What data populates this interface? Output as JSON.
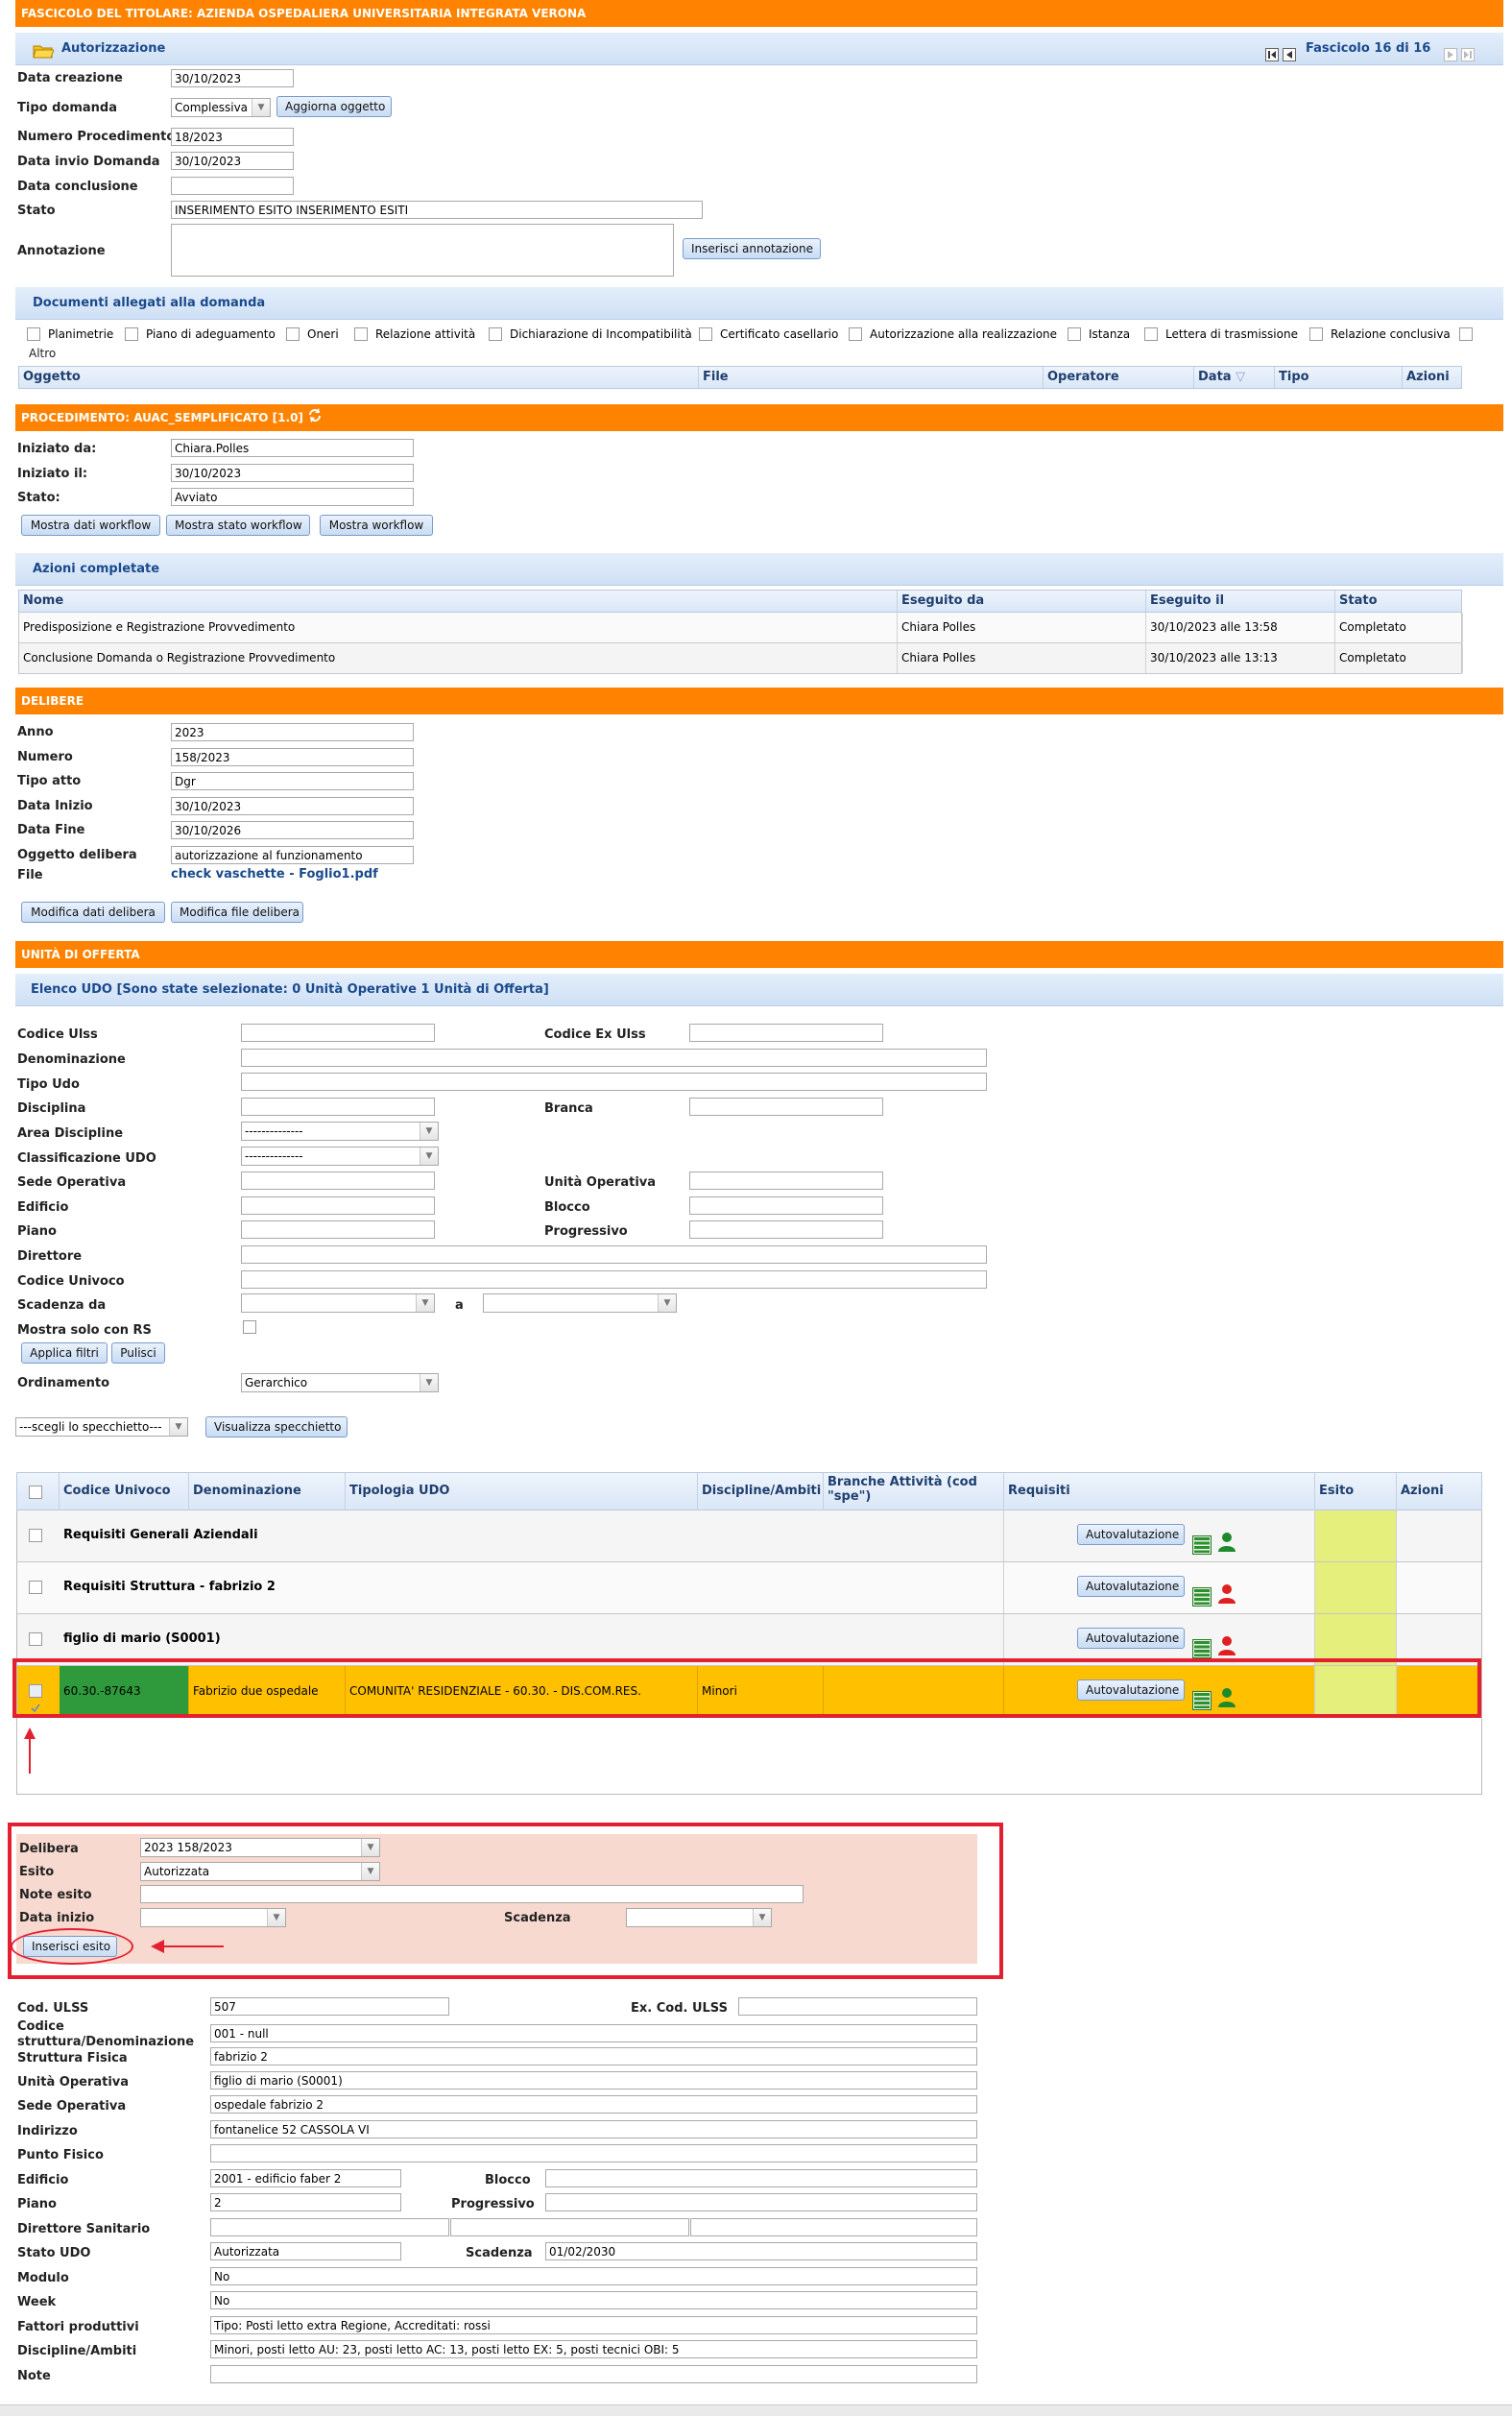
{
  "fascicolo": {
    "title": "FASCICOLO DEL TITOLARE: AZIENDA OSPEDALIERA UNIVERSITARIA INTEGRATA VERONA",
    "tab": "Autorizzazione",
    "pager": "Fascicolo 16 di 16"
  },
  "domanda": {
    "labels": {
      "data_creazione": "Data creazione",
      "tipo_domanda": "Tipo domanda",
      "numero_procedimento": "Numero Procedimento",
      "data_invio": "Data invio Domanda",
      "data_conclusione": "Data conclusione",
      "stato": "Stato",
      "annotazione": "Annotazione"
    },
    "data_creazione": "30/10/2023",
    "tipo_domanda": "Complessiva",
    "aggiorna_btn": "Aggiorna oggetto",
    "numero_procedimento": "18/2023",
    "data_invio": "30/10/2023",
    "data_conclusione": "",
    "stato": "INSERIMENTO ESITO INSERIMENTO ESITI",
    "annotazione": "",
    "inserisci_annotazione_btn": "Inserisci annotazione"
  },
  "documenti": {
    "title": "Documenti allegati alla domanda",
    "checkboxes": [
      "Planimetrie",
      "Piano di adeguamento",
      "Oneri",
      "Relazione attività",
      "Dichiarazione di Incompatibilità",
      "Certificato casellario",
      "Autorizzazione alla realizzazione",
      "Istanza",
      "Lettera di trasmissione",
      "Relazione conclusiva"
    ],
    "extra": "Altro",
    "columns": [
      "Oggetto",
      "File",
      "Operatore",
      "Data",
      "Tipo",
      "Azioni"
    ]
  },
  "procedimento": {
    "title": "PROCEDIMENTO: AUAC_SEMPLIFICATO [1.0]",
    "labels": {
      "iniziato_da": "Iniziato da:",
      "iniziato_il": "Iniziato il:",
      "stato": "Stato:"
    },
    "iniziato_da": "Chiara.Polles",
    "iniziato_il": "30/10/2023",
    "stato": "Avviato",
    "buttons": [
      "Mostra dati workflow",
      "Mostra stato workflow",
      "Mostra workflow"
    ]
  },
  "azioni": {
    "title": "Azioni completate",
    "columns": [
      "Nome",
      "Eseguito da",
      "Eseguito il",
      "Stato"
    ],
    "rows": [
      [
        "Predisposizione e Registrazione Provvedimento",
        "Chiara Polles",
        "30/10/2023 alle 13:58",
        "Completato"
      ],
      [
        "Conclusione Domanda o Registrazione Provvedimento",
        "Chiara Polles",
        "30/10/2023 alle 13:13",
        "Completato"
      ]
    ]
  },
  "delibere": {
    "title": "DELIBERE",
    "labels": {
      "anno": "Anno",
      "numero": "Numero",
      "tipo_atto": "Tipo atto",
      "data_inizio": "Data Inizio",
      "data_fine": "Data Fine",
      "oggetto": "Oggetto delibera",
      "file": "File"
    },
    "anno": "2023",
    "numero": "158/2023",
    "tipo_atto": "Dgr",
    "data_inizio": "30/10/2023",
    "data_fine": "30/10/2026",
    "oggetto": "autorizzazione al funzionamento",
    "file": "check vaschette - Foglio1.pdf",
    "buttons": [
      "Modifica dati delibera",
      "Modifica file delibera"
    ]
  },
  "unita": {
    "title": "UNITÀ DI OFFERTA",
    "elenco": "Elenco UDO [Sono state selezionate: 0 Unità Operative 1 Unità di Offerta]",
    "filters": {
      "codice_ulss": "Codice Ulss",
      "codice_ex_ulss": "Codice Ex Ulss",
      "denominazione": "Denominazione",
      "tipo_udo": "Tipo Udo",
      "disciplina": "Disciplina",
      "branca": "Branca",
      "area_discipline": "Area Discipline",
      "classificazione": "Classificazione UDO",
      "sede_operativa": "Sede Operativa",
      "unita_operativa": "Unità Operativa",
      "edificio": "Edificio",
      "blocco": "Blocco",
      "piano": "Piano",
      "progressivo": "Progressivo",
      "direttore": "Direttore",
      "codice_univoco": "Codice Univoco",
      "scadenza_da": "Scadenza da",
      "a": "a",
      "mostra_rs": "Mostra solo con RS",
      "ordinamento": "Ordinamento"
    },
    "select_placeholder": "--------------",
    "ordinamento_value": "Gerarchico",
    "applica_btn": "Applica filtri",
    "pulisci_btn": "Pulisci",
    "specchietto": "---scegli lo specchietto---",
    "visualizza_btn": "Visualizza specchietto",
    "columns": [
      "Codice Univoco",
      "Denominazione",
      "Tipologia UDO",
      "Discipline/Ambiti",
      "Branche Attività (cod \"spe\")",
      "Requisiti",
      "Esito",
      "Azioni"
    ],
    "rows": [
      {
        "codice": "Requisiti Generali Aziendali",
        "denominazione": "",
        "tipologia": "",
        "discipline": "",
        "branche": "",
        "person": "#1e8a2c"
      },
      {
        "codice": "Requisiti Struttura - fabrizio 2",
        "denominazione": "",
        "tipologia": "",
        "discipline": "",
        "branche": "",
        "person": "#e0201f"
      },
      {
        "codice": "figlio di mario (S0001)",
        "denominazione": "",
        "tipologia": "",
        "discipline": "",
        "branche": "",
        "person": "#e0201f"
      },
      {
        "codice": "60.30.-87643",
        "denominazione": "Fabrizio due ospedale",
        "tipologia": "COMUNITA' RESIDENZIALE - 60.30. - DIS.COM.RES.",
        "discipline": "Minori",
        "branche": "",
        "person": "#1e8a2c"
      }
    ],
    "autovalutazione_btn": "Autovalutazione"
  },
  "esito": {
    "labels": {
      "delibera": "Delibera",
      "esito": "Esito",
      "note": "Note esito",
      "data_inizio": "Data inizio",
      "scadenza": "Scadenza"
    },
    "delibera": "2023 158/2023",
    "esito": "Autorizzata",
    "note": "",
    "data_inizio": "",
    "scadenza": "",
    "inserisci_btn": "Inserisci esito"
  },
  "dettaglio": {
    "labels": {
      "cod_ulss": "Cod. ULSS",
      "ex_cod_ulss": "Ex. Cod. ULSS",
      "codice_struttura": "Codice struttura/Denominazione",
      "struttura_fisica": "Struttura Fisica",
      "unita_operativa": "Unità Operativa",
      "sede_operativa": "Sede Operativa",
      "indirizzo": "Indirizzo",
      "punto_fisico": "Punto Fisico",
      "edificio": "Edificio",
      "blocco": "Blocco",
      "piano": "Piano",
      "progressivo": "Progressivo",
      "direttore": "Direttore Sanitario",
      "stato_udo": "Stato UDO",
      "scadenza": "Scadenza",
      "modulo": "Modulo",
      "week": "Week",
      "fattori": "Fattori produttivi",
      "discipline": "Discipline/Ambiti",
      "note": "Note"
    },
    "cod_ulss": "507",
    "ex_cod_ulss": "",
    "codice_struttura": "001 - null",
    "struttura_fisica": "fabrizio 2",
    "unita_operativa": "figlio di mario  (S0001)",
    "sede_operativa": "ospedale fabrizio 2",
    "indirizzo": "fontanelice  52 CASSOLA VI",
    "punto_fisico": "",
    "edificio": "2001 - edificio faber 2",
    "blocco": "",
    "piano": "2",
    "progressivo": "",
    "stato_udo": "Autorizzata",
    "scadenza": "01/02/2030",
    "modulo": "No",
    "week": "No",
    "fattori": "Tipo: Posti letto extra Regione, Accreditati: rossi",
    "discipline": "Minori, posti letto AU: 23, posti letto AC: 13, posti letto EX: 5, posti tecnici OBI: 5",
    "note": ""
  },
  "colors": {
    "orange": "#ff8300",
    "highlight": "#ffc000",
    "green": "#2e9a3c",
    "esito": "#e4ef7c",
    "pink": "#f7d9cf",
    "red": "#e22030"
  }
}
